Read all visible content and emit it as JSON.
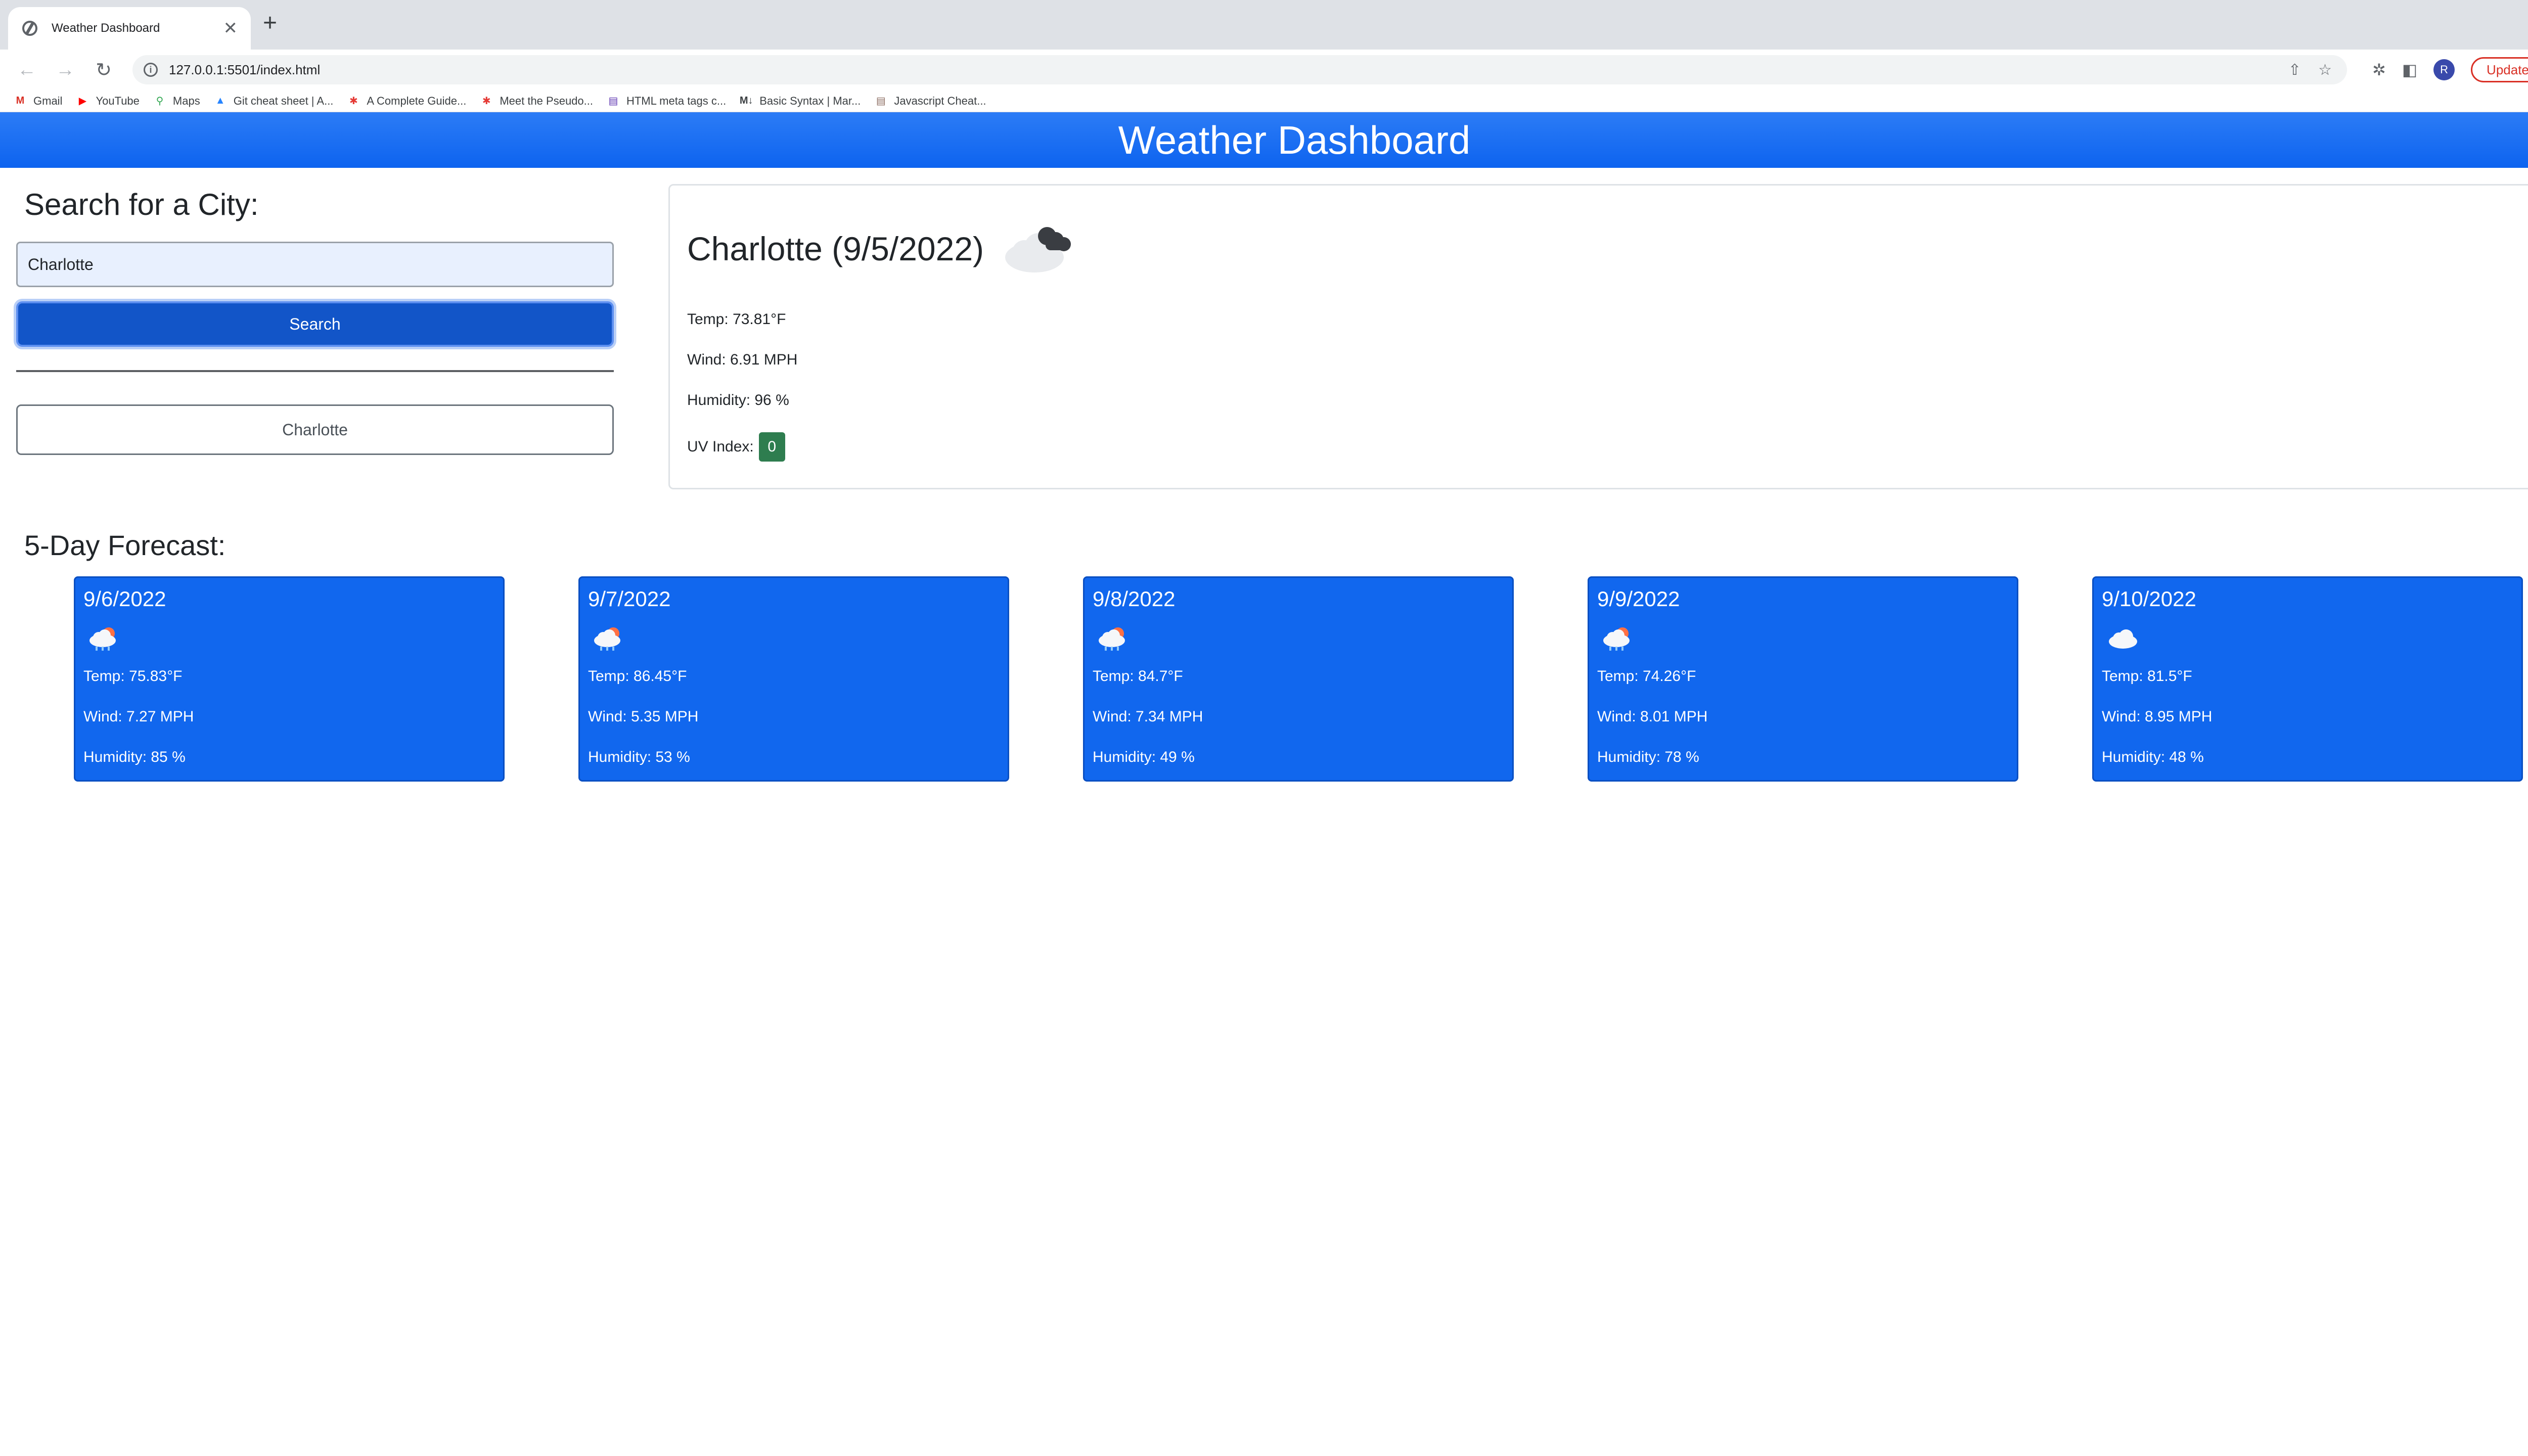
{
  "browser": {
    "tab_title": "Weather Dashboard",
    "tab_close": "✕",
    "new_tab": "+",
    "url": "127.0.0.1:5501/index.html",
    "update_label": "Update",
    "avatar_initial": "R",
    "bookmarks": [
      {
        "label": "Gmail",
        "icon": "gmail-icon",
        "color": "#d93025"
      },
      {
        "label": "YouTube",
        "icon": "youtube-icon",
        "color": "#ff0000"
      },
      {
        "label": "Maps",
        "icon": "maps-icon",
        "color": "#34a853"
      },
      {
        "label": "Git cheat sheet | A...",
        "icon": "atlassian-icon",
        "color": "#2684ff"
      },
      {
        "label": "A Complete Guide...",
        "icon": "asterisk-icon",
        "color": "#e53935"
      },
      {
        "label": "Meet the Pseudo...",
        "icon": "asterisk-icon",
        "color": "#e53935"
      },
      {
        "label": "HTML meta tags c...",
        "icon": "bookmark-page-icon",
        "color": "#5e35b1"
      },
      {
        "label": "Basic Syntax | Mar...",
        "icon": "markdown-icon",
        "color": "#3c4043"
      },
      {
        "label": "Javascript Cheat...",
        "icon": "bookmark-page-icon",
        "color": "#8d6e63"
      }
    ]
  },
  "header": {
    "title": "Weather Dashboard"
  },
  "search": {
    "heading": "Search for a City:",
    "input_value": "Charlotte",
    "button_label": "Search",
    "history": [
      "Charlotte"
    ]
  },
  "current": {
    "title": "Charlotte (9/5/2022)",
    "icon": "broken-clouds-icon",
    "temp": "Temp: 73.81°F",
    "wind": "Wind: 6.91 MPH",
    "humidity": "Humidity: 96 %",
    "uv_label": "UV Index:",
    "uv_value": "0",
    "uv_color": "#2e7d4f"
  },
  "forecast": {
    "heading": "5-Day Forecast:",
    "accent": "#1167ee",
    "days": [
      {
        "date": "9/6/2022",
        "icon": "rain-cloud-sun-icon",
        "temp": "Temp: 75.83°F",
        "wind": "Wind: 7.27 MPH",
        "humidity": "Humidity: 85 %"
      },
      {
        "date": "9/7/2022",
        "icon": "rain-cloud-sun-icon",
        "temp": "Temp: 86.45°F",
        "wind": "Wind: 5.35 MPH",
        "humidity": "Humidity: 53 %"
      },
      {
        "date": "9/8/2022",
        "icon": "rain-cloud-sun-icon",
        "temp": "Temp: 84.7°F",
        "wind": "Wind: 7.34 MPH",
        "humidity": "Humidity: 49 %"
      },
      {
        "date": "9/9/2022",
        "icon": "rain-cloud-sun-icon",
        "temp": "Temp: 74.26°F",
        "wind": "Wind: 8.01 MPH",
        "humidity": "Humidity: 78 %"
      },
      {
        "date": "9/10/2022",
        "icon": "cloud-icon",
        "temp": "Temp: 81.5°F",
        "wind": "Wind: 8.95 MPH",
        "humidity": "Humidity: 48 %"
      }
    ]
  }
}
